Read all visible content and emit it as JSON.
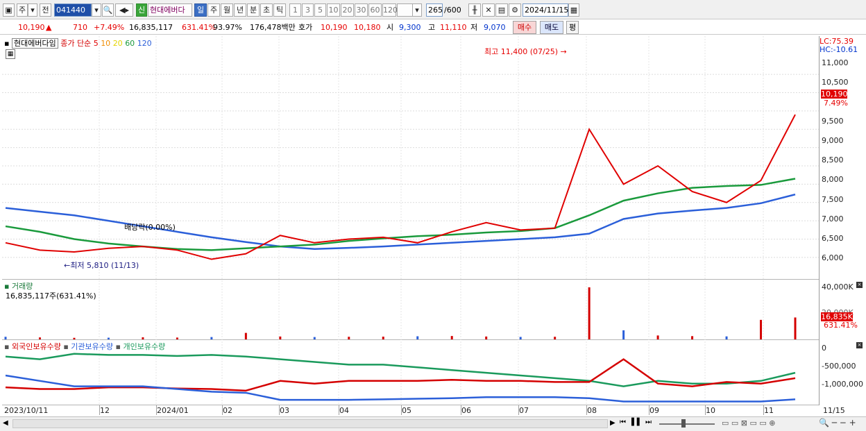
{
  "toolbar": {
    "market": "주",
    "prev": "전",
    "code": "041440",
    "sin_badge": "신",
    "stock_name": "현대에버다",
    "periods": [
      "일",
      "주",
      "월",
      "년",
      "분",
      "초",
      "틱"
    ],
    "active_period": "일",
    "minutes": [
      "1",
      "3",
      "5",
      "10",
      "20",
      "30",
      "60",
      "120"
    ],
    "count": "265",
    "count_total": "/600",
    "date": "2024/11/15"
  },
  "quote": {
    "price": "10,190",
    "arrow": "▲",
    "change": "710",
    "change_pct": "+7.49%",
    "volume": "16,835,117",
    "volume_ratio": "631.41%",
    "turnover": "93.97%",
    "amount": "176,478백만",
    "hoga_label": "호가",
    "ask": "10,190",
    "bid": "10,180",
    "open_label": "시",
    "open": "9,300",
    "high_label": "고",
    "high": "11,110",
    "low_label": "저",
    "low": "9,070",
    "buy_btn": "매수",
    "sell_btn": "매도",
    "eval_btn": "평"
  },
  "price_panel": {
    "title": "현대에버다임",
    "ma_label": "종가 단순",
    "ma_periods": [
      "5",
      "10",
      "20",
      "60",
      "120"
    ],
    "ma_colors": [
      "#e00000",
      "#f08c00",
      "#f5e600",
      "#1a9a3c",
      "#2b5fd9"
    ],
    "lc": "LC:75.39",
    "hc": "HC:-10.61",
    "last_price_tag": "10,190",
    "last_pct_tag": "7.49%",
    "high_note": "최고 11,400 (07/25) →",
    "low_note": "←최저 5,810 (11/13)",
    "dividend_note": "배당락(0.00%)",
    "y_ticks": [
      "11,000",
      "10,500",
      "10,000",
      "9,500",
      "9,000",
      "8,500",
      "8,000",
      "7,500",
      "7,000",
      "6,500",
      "6,000"
    ]
  },
  "volume_panel": {
    "title": "거래량",
    "value": "16,835,117주(631.41%)",
    "y_top": "40,000K",
    "y_mid": "20,000K",
    "last_tag": "16,835K",
    "last_pct": "631.41%"
  },
  "holding_panel": {
    "legend": [
      {
        "label": "외국인보유수량",
        "color": "#d40000"
      },
      {
        "label": "기관보유수량",
        "color": "#2b5fd9"
      },
      {
        "label": "개인보유수량",
        "color": "#1a9a5c"
      }
    ],
    "y_ticks": [
      "0",
      "-500,000",
      "-1,000,000"
    ]
  },
  "x_axis": [
    "2023/10/11",
    "12",
    "2024/01",
    "02",
    "03",
    "04",
    "05",
    "06",
    "07",
    "08",
    "09",
    "10",
    "11",
    "11/15"
  ],
  "chart_data": {
    "type": "line",
    "title": "현대에버다임",
    "ylabel": "",
    "ylim": [
      5600,
      11400
    ],
    "x_ticks": [
      "2023/10/11",
      "12",
      "2024/01",
      "02",
      "03",
      "04",
      "05",
      "06",
      "07",
      "08",
      "09",
      "10",
      "11"
    ],
    "series": [
      {
        "name": "120",
        "values": [
          7350,
          7250,
          7150,
          7000,
          6850,
          6700,
          6550,
          6420,
          6300,
          6230,
          6260,
          6300,
          6350,
          6400,
          6450,
          6500,
          6550,
          6650,
          7050,
          7200,
          7280,
          7350,
          7480,
          7720
        ]
      },
      {
        "name": "60",
        "values": [
          6850,
          6700,
          6500,
          6380,
          6300,
          6230,
          6200,
          6250,
          6300,
          6350,
          6450,
          6520,
          6580,
          6620,
          6680,
          6720,
          6800,
          7150,
          7550,
          7750,
          7900,
          7950,
          7980,
          8150
        ]
      },
      {
        "name": "5",
        "values": [
          6400,
          6200,
          6150,
          6250,
          6300,
          6200,
          5950,
          6100,
          6600,
          6400,
          6500,
          6550,
          6400,
          6700,
          6950,
          6750,
          6800,
          9500,
          8000,
          8500,
          7800,
          7500,
          8100,
          9900
        ]
      }
    ],
    "volume_k": [
      2000,
      1500,
      1200,
      1300,
      1600,
      1400,
      1800,
      5000,
      2200,
      1800,
      2000,
      2100,
      2400,
      2600,
      2200,
      1900,
      2000,
      40000,
      7000,
      3000,
      2500,
      2300,
      15000,
      16835
    ]
  },
  "bottom": {
    "zoom_icons": [
      "◀",
      "▶",
      "⏮",
      "⏭"
    ]
  }
}
